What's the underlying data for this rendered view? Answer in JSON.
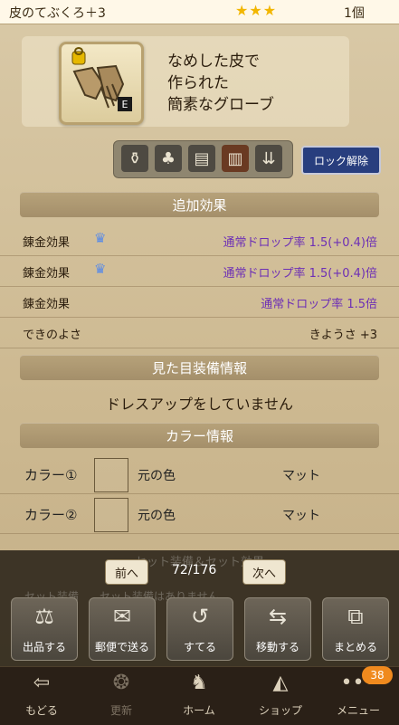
{
  "header": {
    "item_name": "皮のてぶくろ＋3",
    "stars": "★★★",
    "quantity": "1個"
  },
  "item": {
    "equip_mark": "E",
    "description": [
      "なめした皮で",
      "作られた",
      "簡素なグローブ"
    ]
  },
  "iconbar": {
    "icons": [
      "bag-icon",
      "clover-icon",
      "storage-icon",
      "book-icon",
      "sort-icon"
    ]
  },
  "lock_button": "ロック解除",
  "sections": {
    "bonus": "追加効果",
    "appearance": "見た目装備情報",
    "color": "カラー情報",
    "set": "セット装備＆セット効果"
  },
  "bonus_rows": [
    {
      "label": "錬金効果",
      "value": "通常ドロップ率 1.5(+0.4)倍"
    },
    {
      "label": "錬金効果",
      "value": "通常ドロップ率 1.5(+0.4)倍"
    },
    {
      "label": "錬金効果",
      "value": "通常ドロップ率 1.5倍"
    }
  ],
  "quality": {
    "label": "できのよさ",
    "value": "きようさ +3"
  },
  "appearance_text": "ドレスアップをしていません",
  "color_rows": [
    {
      "label": "カラー①",
      "original": "元の色",
      "finish": "マット"
    },
    {
      "label": "カラー②",
      "original": "元の色",
      "finish": "マット"
    }
  ],
  "set_info": {
    "label": "セット装備",
    "value": "セット装備はありません"
  },
  "pager": {
    "prev": "前へ",
    "current": "72/176",
    "next": "次へ"
  },
  "actions": [
    {
      "label": "出品する",
      "icon": "scale-icon"
    },
    {
      "label": "郵便で送る",
      "icon": "mail-icon"
    },
    {
      "label": "すてる",
      "icon": "discard-icon"
    },
    {
      "label": "移動する",
      "icon": "move-icon"
    },
    {
      "label": "まとめる",
      "icon": "stack-icon"
    }
  ],
  "nav": {
    "back": "もどる",
    "refresh": "更新",
    "home": "ホーム",
    "shop": "ショップ",
    "menu": "メニュー",
    "badge": "38"
  },
  "colors": {
    "accent_purple": "#6d2fb5",
    "lock_blue": "#283e7e",
    "badge_orange": "#f08a1e"
  }
}
